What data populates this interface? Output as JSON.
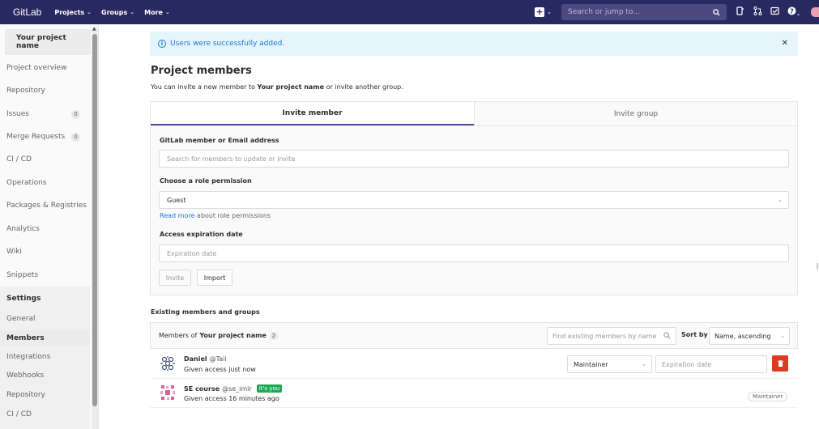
{
  "navbar": {
    "logo": "GitLab",
    "links": [
      "Projects",
      "Groups",
      "More"
    ],
    "search_placeholder": "Search or jump to...",
    "colors": {
      "background": "#292961"
    }
  },
  "sidebar": {
    "project_name": "Your project name",
    "items": [
      {
        "label": "Project overview"
      },
      {
        "label": "Repository"
      },
      {
        "label": "Issues",
        "badge": "0"
      },
      {
        "label": "Merge Requests",
        "badge": "0"
      },
      {
        "label": "CI / CD"
      },
      {
        "label": "Operations"
      },
      {
        "label": "Packages & Registries"
      },
      {
        "label": "Analytics"
      },
      {
        "label": "Wiki"
      },
      {
        "label": "Snippets"
      },
      {
        "label": "Settings"
      }
    ],
    "settings_sub": [
      "General",
      "Members",
      "Integrations",
      "Webhooks",
      "Repository",
      "CI / CD"
    ]
  },
  "alert": {
    "message": "Users were successfully added."
  },
  "main": {
    "title": "Project members",
    "desc_prefix": "You can invite a new member to ",
    "desc_project": "Your project name",
    "desc_suffix": " or invite another group.",
    "tabs": [
      "Invite member",
      "Invite group"
    ],
    "member_label": "GitLab member or Email address",
    "member_placeholder": "Search for members to update or invite",
    "role_label": "Choose a role permission",
    "role_value": "Guest",
    "read_more_link": "Read more",
    "read_more_suffix": " about role permissions",
    "expiration_label": "Access expiration date",
    "expiration_placeholder": "Expiration date",
    "invite_button": "Invite",
    "import_button": "Import"
  },
  "members": {
    "section_title": "Existing members and groups",
    "header_prefix": "Members of",
    "header_project": "Your project name",
    "count": "2",
    "filter_placeholder": "Find existing members by name",
    "sort_label": "Sort by",
    "sort_value": "Name, ascending",
    "rows": [
      {
        "name": "Daniel",
        "username": "@Taii",
        "subtitle": "Given access just now",
        "role": "Maintainer",
        "expiration_placeholder": "Expiration date"
      },
      {
        "name": "SE course",
        "username": "@se_imir",
        "badge": "It's you",
        "subtitle": "Given access 16 minutes ago",
        "role": "Maintainer"
      }
    ]
  }
}
